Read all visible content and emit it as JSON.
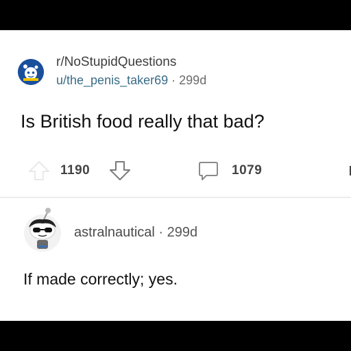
{
  "post": {
    "subreddit": "r/NoStupidQuestions",
    "author": "u/the_penis_taker69",
    "separator": "·",
    "age": "299d",
    "title": "Is British food really that bad?",
    "upvotes": "1190",
    "comments": "1079"
  },
  "comment": {
    "author": "astralnautical",
    "separator": "·",
    "age": "299d",
    "body": "If made correctly; yes."
  },
  "icons": {
    "upvote": "upvote-arrow-icon",
    "downvote": "downvote-arrow-icon",
    "comment": "comment-bubble-icon",
    "subreddit_avatar": "subreddit-avatar-icon",
    "user_avatar": "snoo-avatar-icon"
  },
  "colors": {
    "username": "#3a6c86",
    "background": "#ffffff",
    "frame": "#000000"
  }
}
